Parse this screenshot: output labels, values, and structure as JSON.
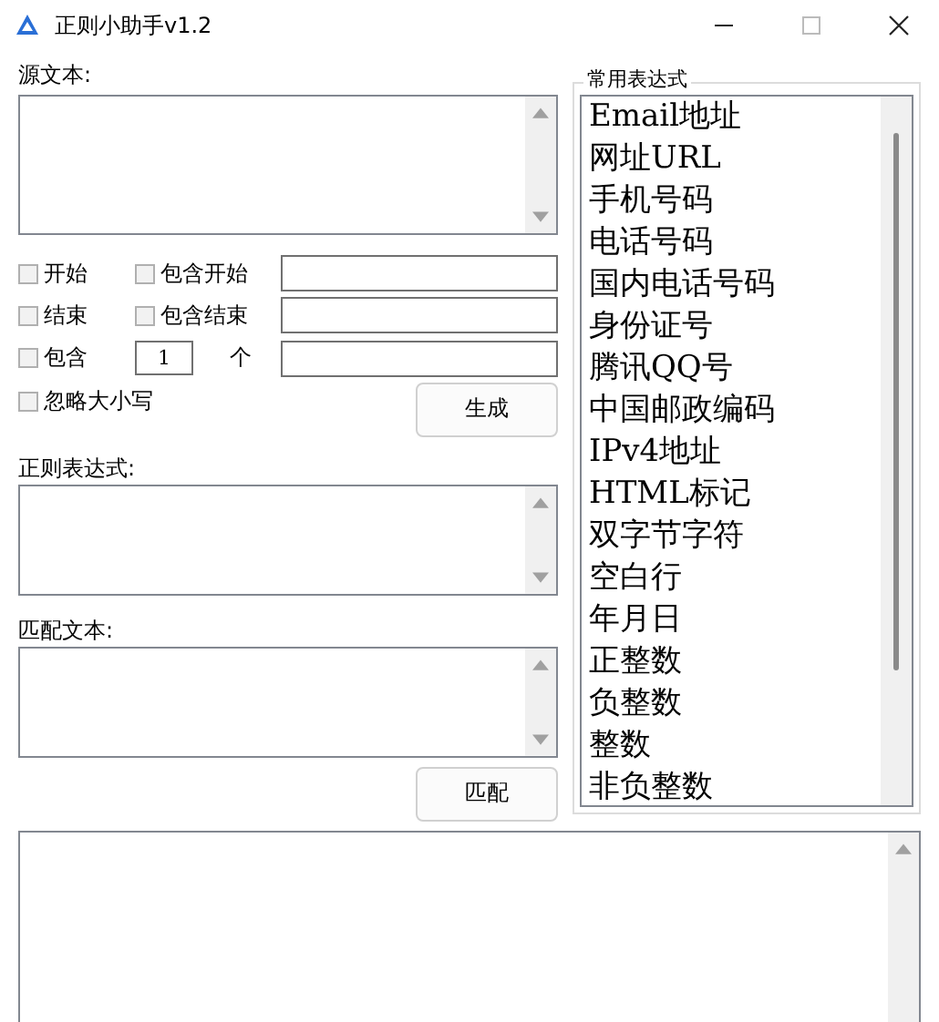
{
  "window": {
    "title": "正则小助手v1.2"
  },
  "source": {
    "label": "源文本:"
  },
  "condition_rows": [
    {
      "items": [
        {
          "kind": "checkbox",
          "label": "开始",
          "checked": false
        },
        {
          "kind": "checkbox",
          "label": "包含开始",
          "checked": false
        },
        {
          "kind": "text_field"
        }
      ]
    },
    {
      "items": [
        {
          "kind": "checkbox",
          "label": "结束",
          "checked": false
        },
        {
          "kind": "checkbox",
          "label": "包含结束",
          "checked": false
        },
        {
          "kind": "text_field"
        }
      ]
    },
    {
      "items": [
        {
          "kind": "checkbox",
          "label": "包含",
          "checked": false
        },
        {
          "kind": "counter",
          "value": "1",
          "unit": "个"
        },
        {
          "kind": "text_field"
        }
      ]
    }
  ],
  "ignore_case": {
    "label": "忽略大小写",
    "checked": false
  },
  "generate_button": "生成",
  "regex": {
    "label": "正则表达式:"
  },
  "match_text": {
    "label": "匹配文本:"
  },
  "match_button": "匹配",
  "presets": {
    "title": "常用表达式",
    "items": [
      "Email地址",
      "网址URL",
      "手机号码",
      "电话号码",
      "国内电话号码",
      "身份证号",
      "腾讯QQ号",
      "中国邮政编码",
      "IPv4地址",
      "HTML标记",
      "双字节字符",
      "空白行",
      "年月日",
      "正整数",
      "负整数",
      "整数",
      "非负整数"
    ]
  }
}
